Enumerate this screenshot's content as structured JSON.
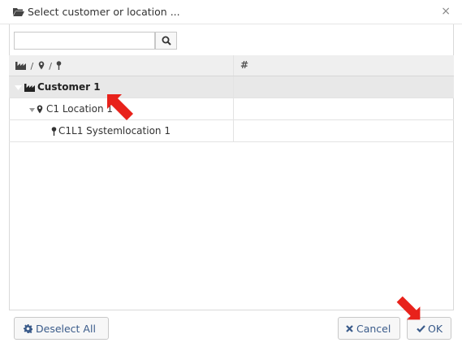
{
  "dialog": {
    "title": "Select customer or location ...",
    "title_icon": "folder-open-icon",
    "close_label": "×"
  },
  "search": {
    "value": "",
    "placeholder": "",
    "button_icon": "search-icon"
  },
  "table": {
    "columns": [
      {
        "label": "/ / ",
        "icons": [
          "industry-icon",
          "map-marker-icon",
          "pin-icon"
        ]
      },
      {
        "label": "#"
      }
    ],
    "rows": [
      {
        "label": "Customer 1",
        "icon": "industry-icon",
        "expander": "collapse-triangle",
        "selected": true
      },
      {
        "label": "C1 Location 1",
        "icon": "map-marker-icon",
        "expander": "collapse-triangle",
        "selected": false
      },
      {
        "label": "C1L1 Systemlocation 1",
        "icon": "pin-icon",
        "selected": false
      }
    ]
  },
  "footer": {
    "deselect_label": "Deselect All",
    "deselect_icon": "gear-icon",
    "cancel_label": "Cancel",
    "cancel_icon": "close-icon",
    "ok_label": "OK",
    "ok_icon": "check-icon"
  },
  "colors": {
    "accent_text": "#3a5b8a",
    "selected_row": "#e8e8e8",
    "annotation_arrow": "#e8221b"
  }
}
